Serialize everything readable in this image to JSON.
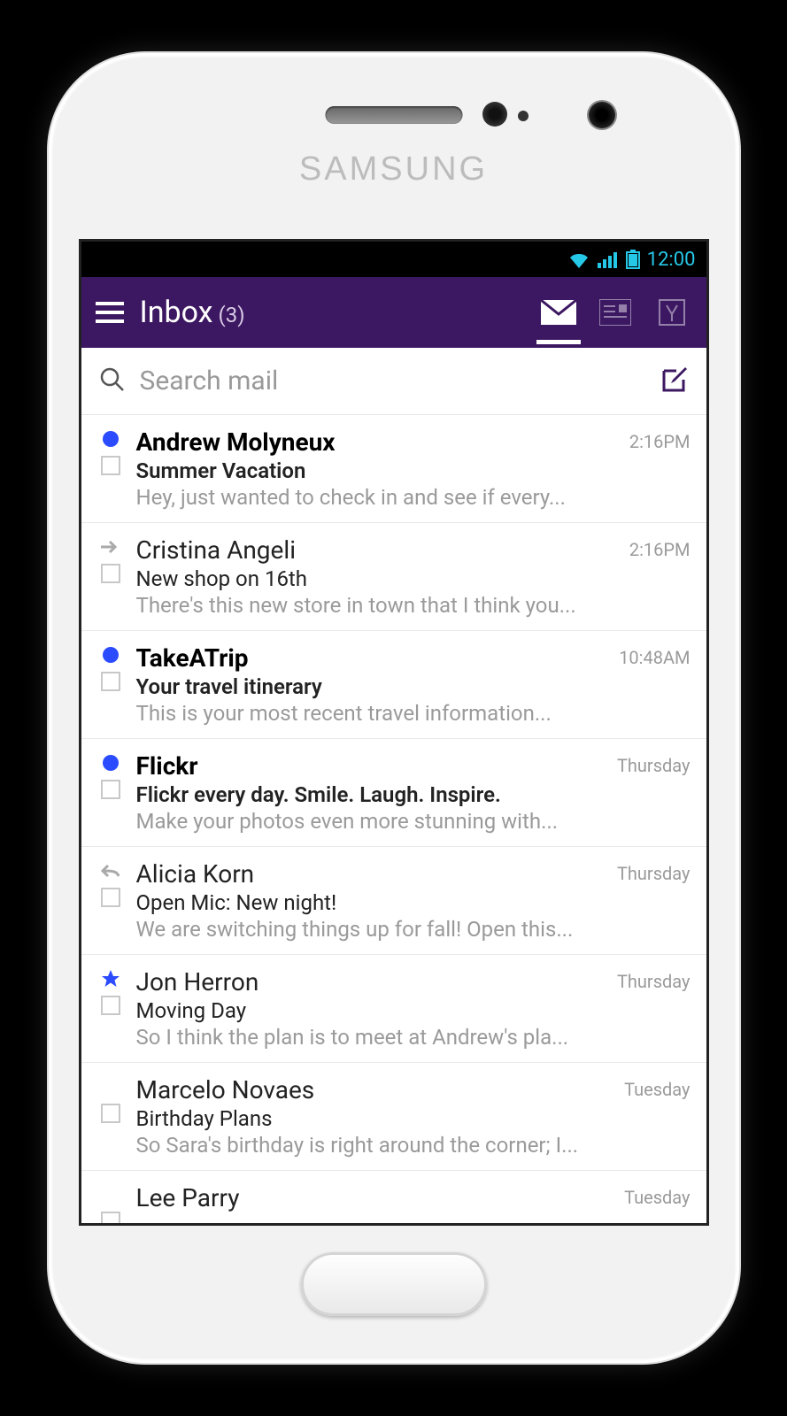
{
  "statusbar": {
    "time": "12:00"
  },
  "appbar": {
    "title": "Inbox",
    "count": "(3)"
  },
  "search": {
    "placeholder": "Search mail"
  },
  "messages": [
    {
      "icon": "dot",
      "unread": true,
      "sender": "Andrew Molyneux",
      "subject": "Summer Vacation",
      "snippet": "Hey, just wanted to check in and see if every...",
      "time": "2:16PM"
    },
    {
      "icon": "fwd",
      "unread": false,
      "sender": "Cristina Angeli",
      "subject": "New shop on 16th",
      "snippet": "There's this new store in town that I think you...",
      "time": "2:16PM"
    },
    {
      "icon": "dot",
      "unread": true,
      "sender": "TakeATrip",
      "subject": "Your travel itinerary",
      "snippet": "This is your most recent travel information...",
      "time": "10:48AM"
    },
    {
      "icon": "dot",
      "unread": true,
      "sender": "Flickr",
      "subject": "Flickr every day. Smile. Laugh. Inspire.",
      "snippet": "Make your photos even more stunning with...",
      "time": "Thursday"
    },
    {
      "icon": "reply",
      "unread": false,
      "sender": "Alicia Korn",
      "subject": "Open Mic: New night!",
      "snippet": "We are switching things up for fall! Open this...",
      "time": "Thursday"
    },
    {
      "icon": "star",
      "unread": false,
      "sender": "Jon Herron",
      "subject": "Moving Day",
      "snippet": "So I think the plan is to meet at Andrew's pla...",
      "time": "Thursday"
    },
    {
      "icon": "none",
      "unread": false,
      "sender": "Marcelo Novaes",
      "subject": "Birthday Plans",
      "snippet": "So Sara's birthday is right around the corner; I...",
      "time": "Tuesday"
    },
    {
      "icon": "none",
      "unread": false,
      "sender": "Lee Parry",
      "subject": "",
      "snippet": "",
      "time": "Tuesday"
    }
  ]
}
